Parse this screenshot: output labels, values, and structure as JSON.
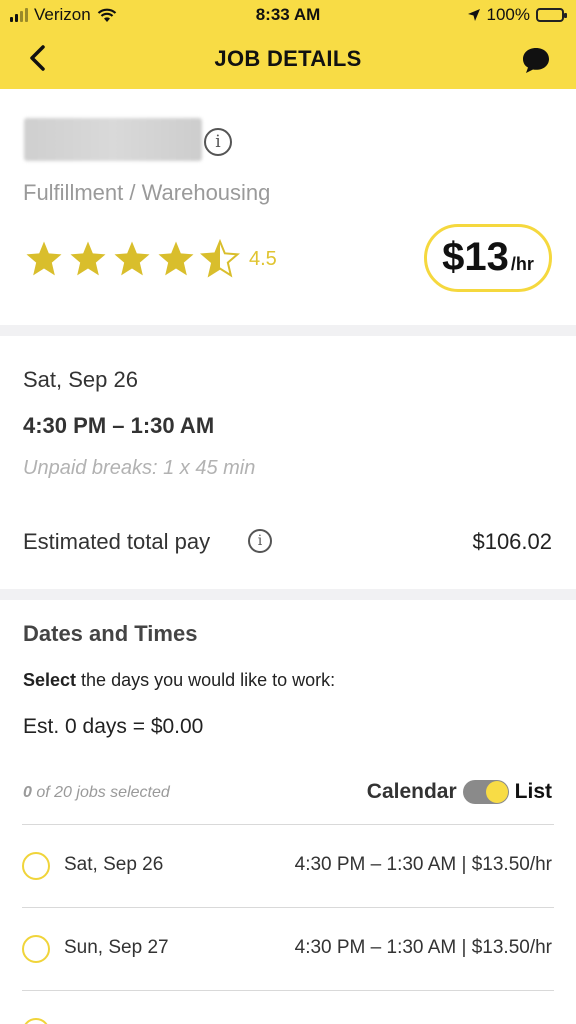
{
  "status_bar": {
    "carrier": "Verizon",
    "time": "8:33 AM",
    "battery": "100%"
  },
  "header": {
    "title": "JOB DETAILS",
    "back_icon": "chevron-left-icon",
    "chat_icon": "chat-bubble-icon"
  },
  "job": {
    "category": "Fulfillment / Warehousing",
    "rating": "4.5",
    "rating_value": 4.5,
    "wage_amount": "$13",
    "wage_unit": "/hr"
  },
  "shift": {
    "date": "Sat, Sep 26",
    "time_range": "4:30 PM – 1:30 AM",
    "breaks": "Unpaid breaks: 1 x 45 min",
    "est_pay_label": "Estimated total pay",
    "est_pay_value": "$106.02"
  },
  "dates_times": {
    "title": "Dates and Times",
    "select_bold": "Select",
    "select_rest": " the days you would like to work:",
    "est_days": "Est. 0 days = $0.00",
    "selected_count_num": "0",
    "selected_count_rest": " of 20 jobs selected",
    "calendar_label": "Calendar",
    "list_label": "List",
    "rows": [
      {
        "date": "Sat, Sep 26",
        "details": "4:30 PM – 1:30 AM  |  $13.50/hr"
      },
      {
        "date": "Sun, Sep 27",
        "details": "4:30 PM – 1:30 AM  |  $13.50/hr"
      }
    ]
  },
  "colors": {
    "accent_yellow": "#f8dc45",
    "star_gold": "#d9be2c"
  }
}
